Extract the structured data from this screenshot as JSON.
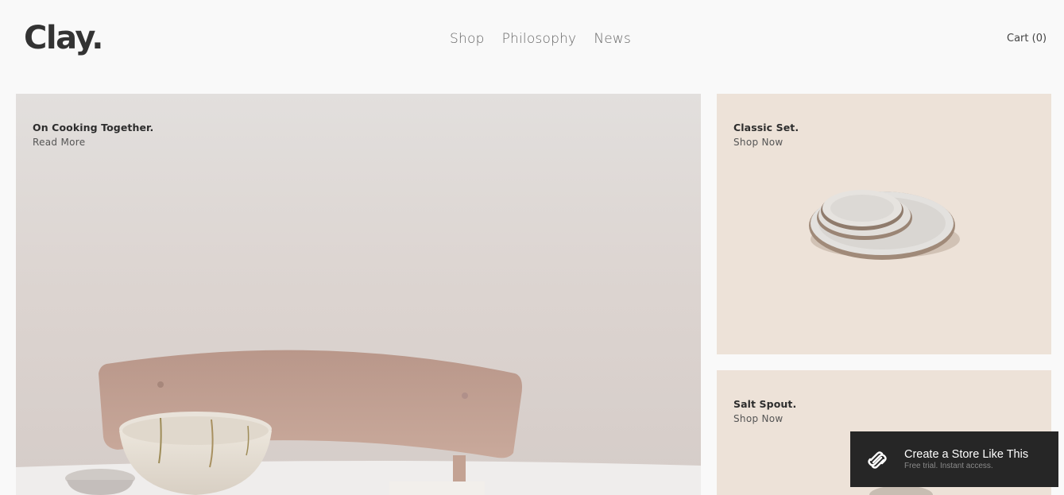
{
  "header": {
    "logo": "Clay.",
    "nav": [
      {
        "label": "Shop"
      },
      {
        "label": "Philosophy"
      },
      {
        "label": "News"
      }
    ],
    "cart_label": "Cart (0)"
  },
  "hero": {
    "title": "On Cooking Together.",
    "link": "Read More"
  },
  "classic": {
    "title": "Classic Set.",
    "link": "Shop Now"
  },
  "salt": {
    "title": "Salt Spout.",
    "link": "Shop Now"
  },
  "promo": {
    "title": "Create a Store Like This",
    "subtitle": "Free trial. Instant access.",
    "icon": "squarespace-logo-icon"
  },
  "colors": {
    "background": "#f9f9f9",
    "panel_tint": "#ede2d8",
    "promo_bg": "#262626",
    "text": "#2d2d2d"
  }
}
